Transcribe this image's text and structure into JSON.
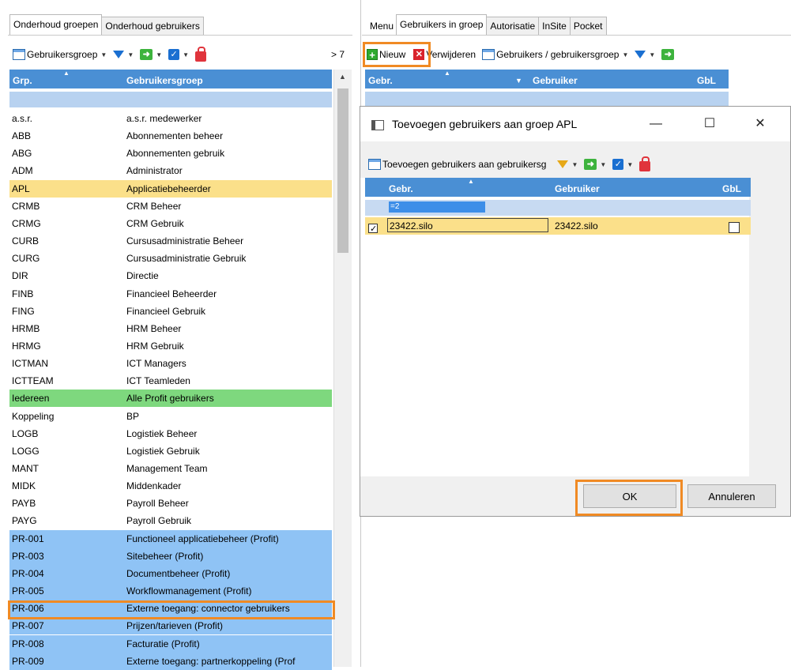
{
  "left_tabs": [
    "Onderhoud groepen",
    "Onderhoud gebruikers"
  ],
  "right_tabs": [
    "Menu",
    "Gebruikers in groep",
    "Autorisatie",
    "InSite",
    "Pocket"
  ],
  "left_toolbar": {
    "groups_label": "Gebruikersgroep",
    "count_label": "> 7"
  },
  "left_grid": {
    "columns": [
      "Grp.",
      "Gebruikersgroep"
    ],
    "rows": [
      {
        "code": "a.s.r.",
        "name": "a.s.r. medewerker"
      },
      {
        "code": "ABB",
        "name": "Abonnementen beheer"
      },
      {
        "code": "ABG",
        "name": "Abonnementen gebruik"
      },
      {
        "code": "ADM",
        "name": "Administrator"
      },
      {
        "code": "APL",
        "name": "Applicatiebeheerder"
      },
      {
        "code": "CRMB",
        "name": "CRM Beheer"
      },
      {
        "code": "CRMG",
        "name": "CRM Gebruik"
      },
      {
        "code": "CURB",
        "name": "Cursusadministratie Beheer"
      },
      {
        "code": "CURG",
        "name": "Cursusadministratie Gebruik"
      },
      {
        "code": "DIR",
        "name": "Directie"
      },
      {
        "code": "FINB",
        "name": "Financieel Beheerder"
      },
      {
        "code": "FING",
        "name": "Financieel Gebruik"
      },
      {
        "code": "HRMB",
        "name": "HRM Beheer"
      },
      {
        "code": "HRMG",
        "name": "HRM Gebruik"
      },
      {
        "code": "ICTMAN",
        "name": "ICT Managers"
      },
      {
        "code": "ICTTEAM",
        "name": "ICT Teamleden"
      },
      {
        "code": "Iedereen",
        "name": "Alle Profit gebruikers"
      },
      {
        "code": "Koppeling",
        "name": "BP"
      },
      {
        "code": "LOGB",
        "name": "Logistiek Beheer"
      },
      {
        "code": "LOGG",
        "name": "Logistiek Gebruik"
      },
      {
        "code": "MANT",
        "name": "Management Team"
      },
      {
        "code": "MIDK",
        "name": "Middenkader"
      },
      {
        "code": "PAYB",
        "name": "Payroll Beheer"
      },
      {
        "code": "PAYG",
        "name": "Payroll Gebruik"
      },
      {
        "code": "PR-001",
        "name": "Functioneel applicatiebeheer (Profit)"
      },
      {
        "code": "PR-003",
        "name": "Sitebeheer (Profit)"
      },
      {
        "code": "PR-004",
        "name": "Documentbeheer (Profit)"
      },
      {
        "code": "PR-005",
        "name": "Workflowmanagement (Profit)"
      },
      {
        "code": "PR-006",
        "name": "Externe toegang: connector gebruikers"
      },
      {
        "code": "PR-007",
        "name": "Prijzen/tarieven (Profit)"
      },
      {
        "code": "PR-008",
        "name": "Facturatie (Profit)"
      },
      {
        "code": "PR-009",
        "name": "Externe toegang: partnerkoppeling (Prof"
      }
    ]
  },
  "right_toolbar": {
    "new_label": "Nieuw",
    "delete_label": "Verwijderen",
    "groups_label": "Gebruikers / gebruikersgroep"
  },
  "right_grid": {
    "columns": [
      "Gebr.",
      "Gebruiker",
      "GbL"
    ]
  },
  "dialog": {
    "title": "Toevoegen gebruikers aan groep APL",
    "toolbar_label": "Toevoegen gebruikers aan gebruikersg",
    "columns": [
      "Gebr.",
      "Gebruiker",
      "GbL"
    ],
    "filter_value": "=2",
    "row": {
      "code": "23422.silo",
      "name": "23422.silo"
    },
    "ok_label": "OK",
    "cancel_label": "Annuleren"
  }
}
